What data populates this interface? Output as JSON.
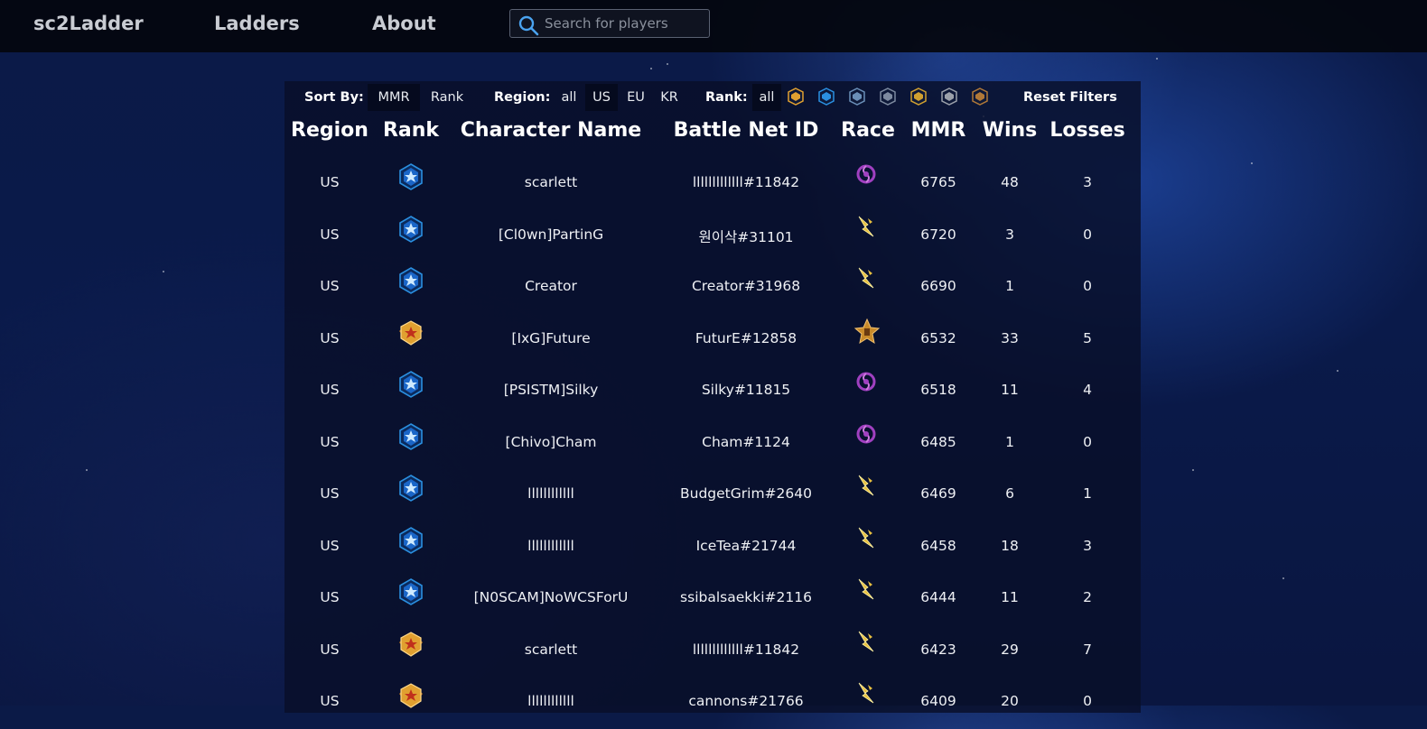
{
  "nav": {
    "brand": "sc2Ladder",
    "links": [
      "Ladders",
      "About"
    ],
    "search_placeholder": "Search for players"
  },
  "filters": {
    "sort_by": {
      "label": "Sort By:",
      "options": [
        "MMR",
        "Rank"
      ],
      "selected": "MMR"
    },
    "region": {
      "label": "Region:",
      "options": [
        "all",
        "US",
        "EU",
        "KR"
      ],
      "selected": "US"
    },
    "rank": {
      "label": "Rank:",
      "options": [
        "all"
      ],
      "selected": "all",
      "league_icons": [
        "grandmaster-icon",
        "master-icon",
        "diamond-icon",
        "platinum-icon",
        "gold-icon",
        "silver-icon",
        "bronze-icon"
      ]
    },
    "reset_label": "Reset Filters"
  },
  "table": {
    "columns": [
      "Region",
      "Rank",
      "Character Name",
      "Battle Net ID",
      "Race",
      "MMR",
      "Wins",
      "Losses"
    ],
    "rows": [
      {
        "region": "US",
        "rank": "master",
        "name": "scarlett",
        "battletag": "lllllllllllll#11842",
        "race": "zerg",
        "mmr": "6765",
        "wins": "48",
        "losses": "3"
      },
      {
        "region": "US",
        "rank": "master",
        "name": "[Cl0wn]PartinG",
        "battletag": "원이삭#31101",
        "race": "protoss",
        "mmr": "6720",
        "wins": "3",
        "losses": "0"
      },
      {
        "region": "US",
        "rank": "master",
        "name": "Creator",
        "battletag": "Creator#31968",
        "race": "protoss",
        "mmr": "6690",
        "wins": "1",
        "losses": "0"
      },
      {
        "region": "US",
        "rank": "grandmaster",
        "name": "[IxG]Future",
        "battletag": "FuturE#12858",
        "race": "terran",
        "mmr": "6532",
        "wins": "33",
        "losses": "5"
      },
      {
        "region": "US",
        "rank": "master",
        "name": "[PSISTM]Silky",
        "battletag": "Silky#11815",
        "race": "zerg",
        "mmr": "6518",
        "wins": "11",
        "losses": "4"
      },
      {
        "region": "US",
        "rank": "master",
        "name": "[Chivo]Cham",
        "battletag": "Cham#1124",
        "race": "zerg",
        "mmr": "6485",
        "wins": "1",
        "losses": "0"
      },
      {
        "region": "US",
        "rank": "master",
        "name": "llllllllllll",
        "battletag": "BudgetGrim#2640",
        "race": "protoss",
        "mmr": "6469",
        "wins": "6",
        "losses": "1"
      },
      {
        "region": "US",
        "rank": "master",
        "name": "llllllllllll",
        "battletag": "IceTea#21744",
        "race": "protoss",
        "mmr": "6458",
        "wins": "18",
        "losses": "3"
      },
      {
        "region": "US",
        "rank": "master",
        "name": "[N0SCAM]NoWCSForU",
        "battletag": "ssibalsaekki#2116",
        "race": "protoss",
        "mmr": "6444",
        "wins": "11",
        "losses": "2"
      },
      {
        "region": "US",
        "rank": "grandmaster",
        "name": "scarlett",
        "battletag": "lllllllllllll#11842",
        "race": "protoss",
        "mmr": "6423",
        "wins": "29",
        "losses": "7"
      },
      {
        "region": "US",
        "rank": "grandmaster",
        "name": "llllllllllll",
        "battletag": "cannons#21766",
        "race": "protoss",
        "mmr": "6409",
        "wins": "20",
        "losses": "0"
      }
    ]
  },
  "colors": {
    "master": "#2a8fe0",
    "grandmaster": "#e0a030",
    "zerg": "#a040c0",
    "protoss": "#e8c040",
    "terran": "#c88a2a"
  }
}
